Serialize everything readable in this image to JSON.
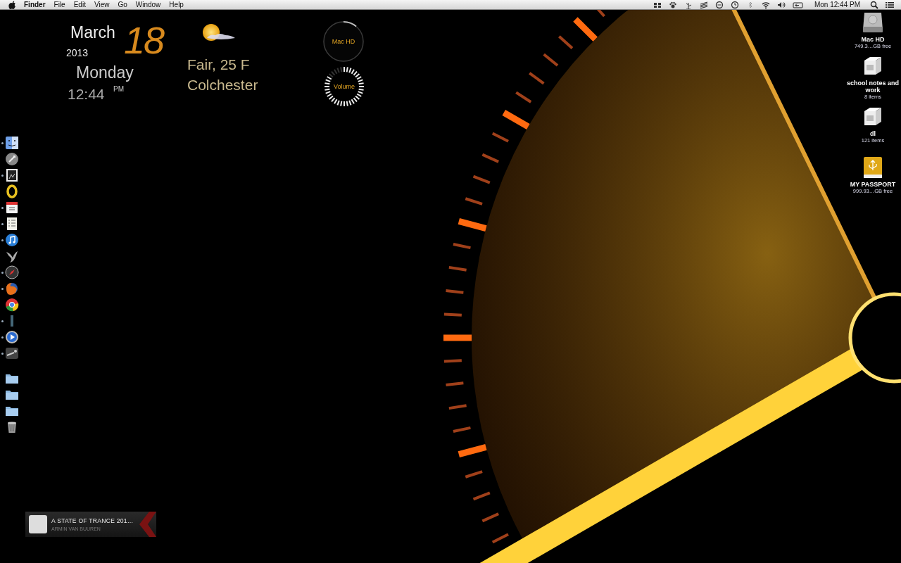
{
  "menu_bar": {
    "app_name": "Finder",
    "menus": [
      "File",
      "Edit",
      "View",
      "Go",
      "Window",
      "Help"
    ],
    "clock": "Mon 12:44 PM"
  },
  "clock_widget": {
    "month": "March",
    "day": "18",
    "year": "2013",
    "weekday": "Monday",
    "time": "12:44",
    "meridiem": "PM"
  },
  "weather_widget": {
    "condition": "Fair, 25 F",
    "location": "Colchester"
  },
  "gauges": [
    {
      "kind": "ring",
      "label": "Mac HD"
    },
    {
      "kind": "ticks",
      "label": "Volume",
      "level": 0.85
    }
  ],
  "dock": {
    "items": [
      {
        "kind": "app",
        "running": true
      },
      {
        "kind": "app",
        "running": false
      },
      {
        "kind": "app",
        "running": true
      },
      {
        "kind": "app",
        "running": false
      },
      {
        "kind": "app",
        "running": true
      },
      {
        "kind": "app",
        "running": true
      },
      {
        "kind": "app",
        "running": true
      },
      {
        "kind": "app",
        "running": false
      },
      {
        "kind": "app",
        "running": true
      },
      {
        "kind": "app",
        "running": true
      },
      {
        "kind": "app",
        "running": false
      },
      {
        "kind": "app",
        "running": true
      },
      {
        "kind": "app",
        "running": true
      },
      {
        "kind": "app",
        "running": true
      },
      {
        "kind": "folder",
        "running": false
      },
      {
        "kind": "folder",
        "running": false
      },
      {
        "kind": "folder",
        "running": false
      },
      {
        "kind": "trash",
        "running": false
      }
    ]
  },
  "desktop_icons": [
    {
      "kind": "drive",
      "name": "Mac HD",
      "info": "749.3…GB free"
    },
    {
      "kind": "box",
      "name": "school notes and work",
      "info": "8 items"
    },
    {
      "kind": "box",
      "name": "dl",
      "info": "121 items"
    },
    {
      "kind": "usb",
      "name": "MY PASSPORT",
      "info": "999.93…GB free"
    }
  ],
  "now_playing": {
    "title": "A STATE OF TRANCE 201…",
    "artist": "ARMIN VAN BUUREN"
  }
}
